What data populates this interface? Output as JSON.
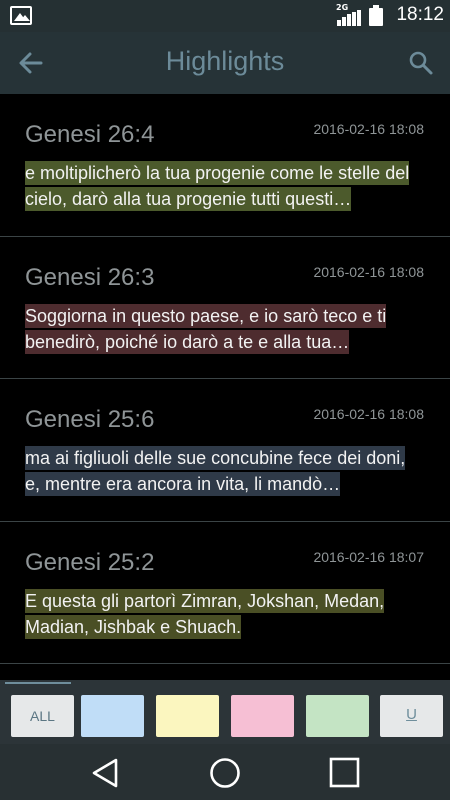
{
  "status_bar": {
    "network_type": "2G",
    "time": "18:12"
  },
  "app_bar": {
    "title": "Highlights",
    "back_icon": "arrow-left-icon",
    "search_icon": "search-icon"
  },
  "highlights": [
    {
      "reference": "Genesi 26:4",
      "timestamp": "2016-02-16 18:08",
      "text": "e moltiplicherò la tua progenie come le stelle del cielo, darò alla tua progenie tutti questi…",
      "highlight_color": "#4c5a2c"
    },
    {
      "reference": "Genesi 26:3",
      "timestamp": "2016-02-16 18:08",
      "text": "Soggiorna in questo paese, e io sarò teco e ti benedirò, poiché io darò a te e alla tua…",
      "highlight_color": "#4e2c2f"
    },
    {
      "reference": "Genesi 25:6",
      "timestamp": "2016-02-16 18:08",
      "text": "ma ai figliuoli delle sue concubine fece dei doni, e, mentre era ancora in vita, li mandò…",
      "highlight_color": "#2f3a48"
    },
    {
      "reference": "Genesi 25:2",
      "timestamp": "2016-02-16 18:07",
      "text": "E questa gli partorì Zimran, Jokshan, Medan, Madian, Jishbak e Shuach.",
      "highlight_color": "#4a4f25"
    }
  ],
  "filters": {
    "all_label": "ALL",
    "underline_label": "U",
    "colors": [
      "#c0ddf7",
      "#fbf6bf",
      "#f6bfd4",
      "#c4e4c4"
    ],
    "active": "ALL"
  },
  "nav_bar": {
    "back_icon": "triangle-back-icon",
    "home_icon": "circle-home-icon",
    "recents_icon": "square-recents-icon"
  }
}
